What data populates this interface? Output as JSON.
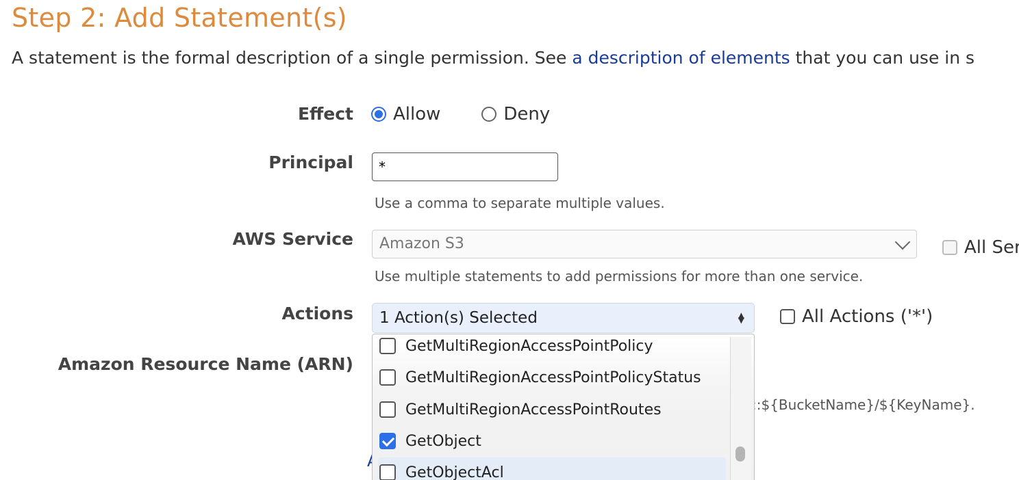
{
  "header": {
    "title": "Step 2: Add Statement(s)",
    "intro_prefix": "A statement is the formal description of a single permission. See ",
    "intro_link": "a description of elements",
    "intro_suffix": " that you can use in s"
  },
  "effect": {
    "label": "Effect",
    "options": [
      "Allow",
      "Deny"
    ],
    "selected": "Allow"
  },
  "principal": {
    "label": "Principal",
    "value": "*",
    "help": "Use a comma to separate multiple values."
  },
  "service": {
    "label": "AWS Service",
    "selected": "Amazon S3",
    "help": "Use multiple statements to add permissions for more than one service.",
    "all_services_label": "All Ser"
  },
  "actions": {
    "label": "Actions",
    "summary": "1 Action(s) Selected",
    "all_actions_label": "All Actions ('*')",
    "items": [
      {
        "label": "GetMultiRegionAccessPointPolicy",
        "checked": false
      },
      {
        "label": "GetMultiRegionAccessPointPolicyStatus",
        "checked": false
      },
      {
        "label": "GetMultiRegionAccessPointRoutes",
        "checked": false
      },
      {
        "label": "GetObject",
        "checked": true
      },
      {
        "label": "GetObjectAcl",
        "checked": false
      }
    ]
  },
  "arn": {
    "label": "Amazon Resource Name (ARN)",
    "hint_fragment": "::${BucketName}/${KeyName}."
  },
  "partial_glyph": "A",
  "colors": {
    "title": "#dd8a3c",
    "link": "#1a3c96",
    "accent": "#2c6fe6"
  }
}
